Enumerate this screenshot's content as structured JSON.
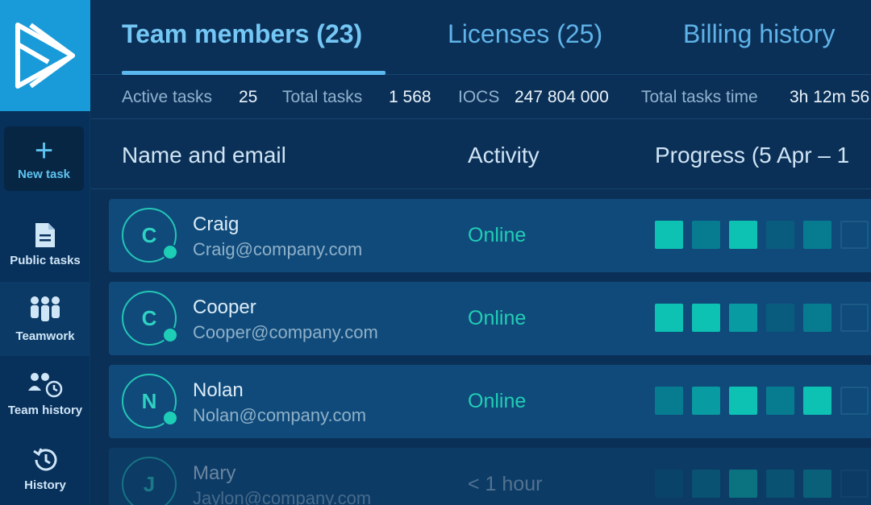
{
  "sidebar": {
    "new_task_label": "New task",
    "items": [
      {
        "label": "Public tasks",
        "icon": "document-icon"
      },
      {
        "label": "Teamwork",
        "icon": "team-icon"
      },
      {
        "label": "Team history",
        "icon": "team-history-icon"
      },
      {
        "label": "History",
        "icon": "history-icon"
      }
    ]
  },
  "tabs": [
    {
      "label": "Team members (23)",
      "active": true
    },
    {
      "label": "Licenses (25)",
      "active": false
    },
    {
      "label": "Billing history",
      "active": false
    }
  ],
  "stats": {
    "active_tasks_label": "Active tasks",
    "active_tasks_value": "25",
    "total_tasks_label": "Total tasks",
    "total_tasks_value": "1 568",
    "iocs_label": "IOCS",
    "iocs_value": "247 804 000",
    "total_time_label": "Total tasks time",
    "total_time_value": "3h 12m 56"
  },
  "table": {
    "columns": [
      "Name and email",
      "Activity",
      "Progress (5 Apr – 1"
    ],
    "rows": [
      {
        "initial": "C",
        "name": "Craig",
        "email": "Craig@company.com",
        "activity": "Online"
      },
      {
        "initial": "C",
        "name": "Cooper",
        "email": "Cooper@company.com",
        "activity": "Online"
      },
      {
        "initial": "N",
        "name": "Nolan",
        "email": "Nolan@company.com",
        "activity": "Online"
      },
      {
        "initial": "J",
        "name": "Mary",
        "email": "Jaylon@company.com",
        "activity": "< 1 hour"
      }
    ]
  },
  "colors": {
    "logo_bg": "#1a9bd9",
    "accent_teal": "#22cdb5",
    "progress_levels": [
      "#0c3c62",
      "#0a5c7f",
      "#077c91",
      "#089ba1",
      "#0dc2b2"
    ]
  },
  "progress": [
    [
      4,
      2,
      4,
      1,
      2,
      0
    ],
    [
      4,
      4,
      3,
      1,
      2,
      0
    ],
    [
      2,
      3,
      4,
      2,
      4,
      0
    ],
    [
      1,
      2,
      4,
      2,
      3,
      0
    ]
  ]
}
